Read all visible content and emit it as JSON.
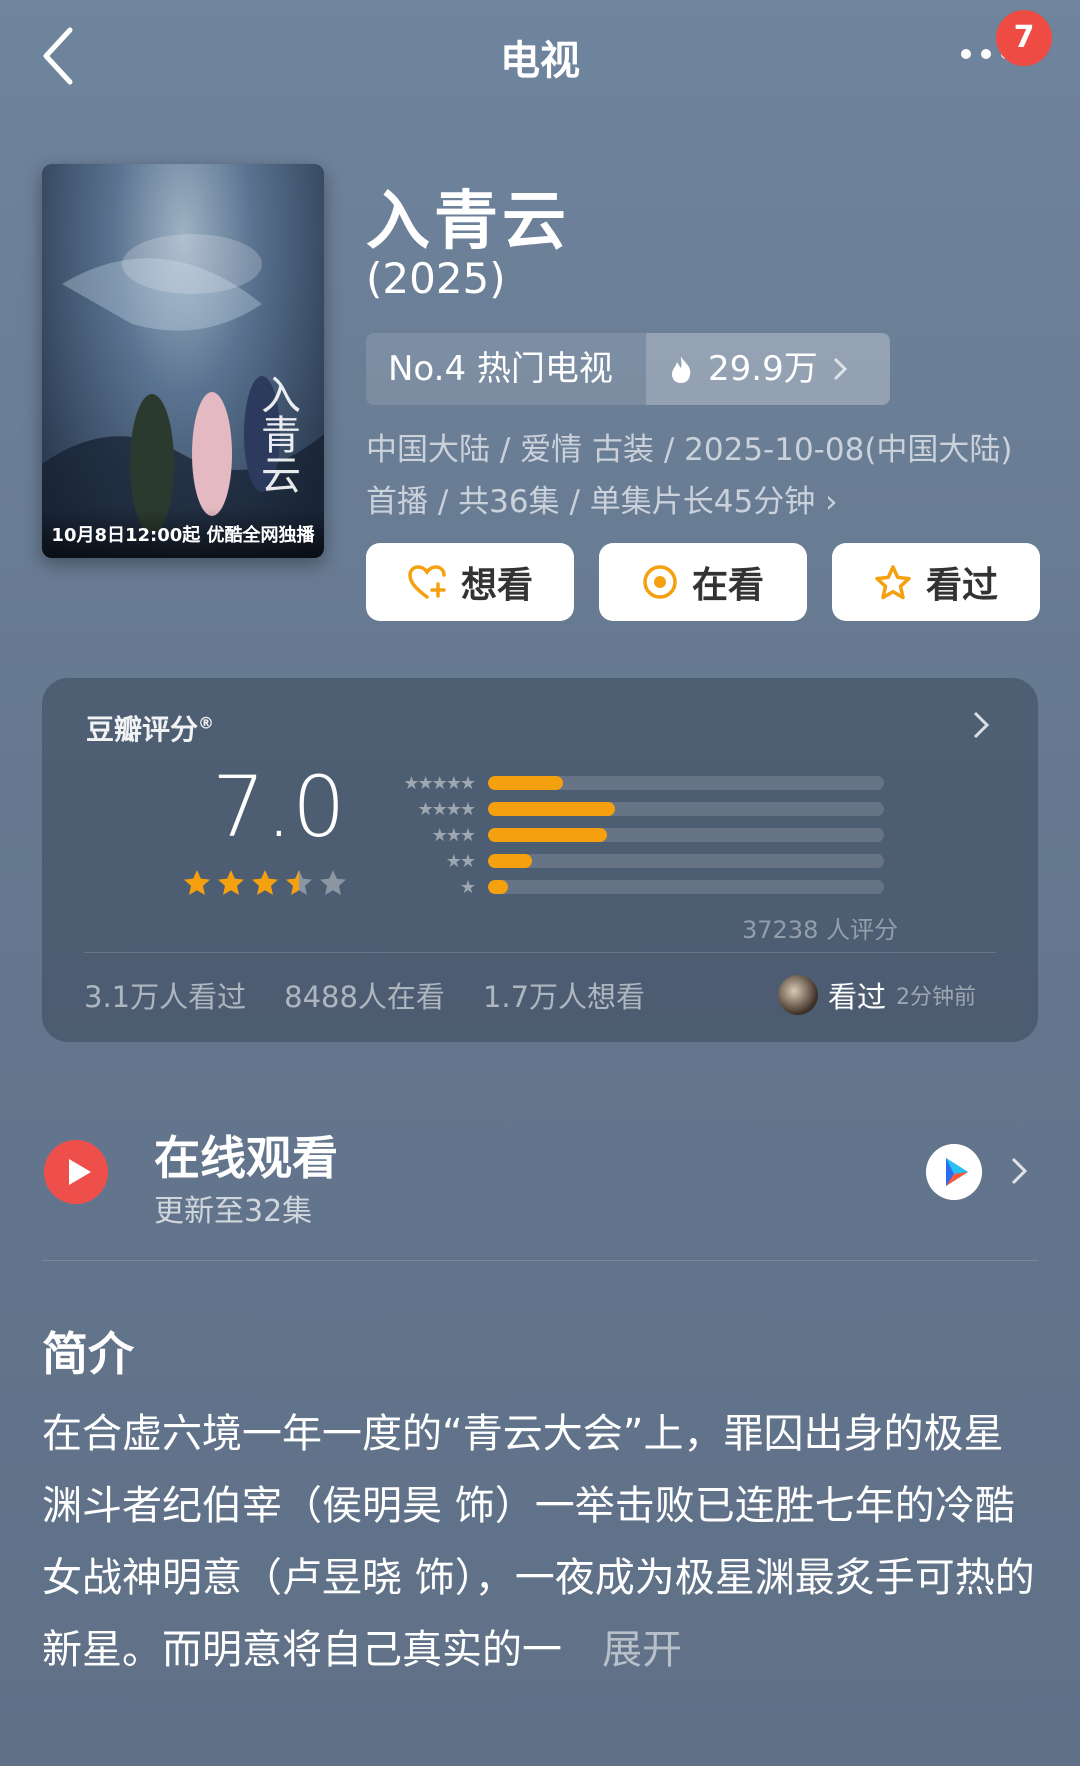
{
  "header": {
    "title": "电视",
    "badge_count": "7"
  },
  "poster": {
    "caption": "10月8日12:00起 优酷全网独播",
    "title_art": "入青云"
  },
  "movie": {
    "name": "入青云",
    "year": "(2025)",
    "rank_label": "No.4 热门电视",
    "heat": "29.9万",
    "meta": "中国大陆 / 爱情 古装 / 2025-10-08(中国大陆)首播 / 共36集 / 单集片长45分钟"
  },
  "actions": {
    "want": "想看",
    "watching": "在看",
    "watched": "看过"
  },
  "rating": {
    "label": "豆瓣评分",
    "registered": "®",
    "score": "7.0",
    "star_value": 3.5,
    "distribution": [
      {
        "stars": "★★★★★",
        "fraction": 0.19
      },
      {
        "stars": "★★★★",
        "fraction": 0.32
      },
      {
        "stars": "★★★",
        "fraction": 0.3
      },
      {
        "stars": "★★",
        "fraction": 0.11
      },
      {
        "stars": "★",
        "fraction": 0.05
      }
    ],
    "votes": "37238 人评分",
    "watched_count": "3.1万人看过",
    "watching_count": "8488人在看",
    "want_count": "1.7万人想看",
    "friend_status": "看过",
    "friend_time": "2分钟前"
  },
  "online": {
    "title": "在线观看",
    "subtitle": "更新至32集"
  },
  "intro": {
    "title": "简介",
    "text": "在合虚六境一年一度的“青云大会”上，罪囚出身的极星渊斗者纪伯宰（侯明昊 饰）一举击败已连胜七年的冷酷女战神明意（卢昱晓 饰），一夜成为极星渊最炙手可热的新星。而明意将自己真实的一",
    "expand": "展开"
  },
  "colors": {
    "accent": "#f5a00f",
    "badge": "#ef4b45",
    "play": "#ee4f4a"
  }
}
